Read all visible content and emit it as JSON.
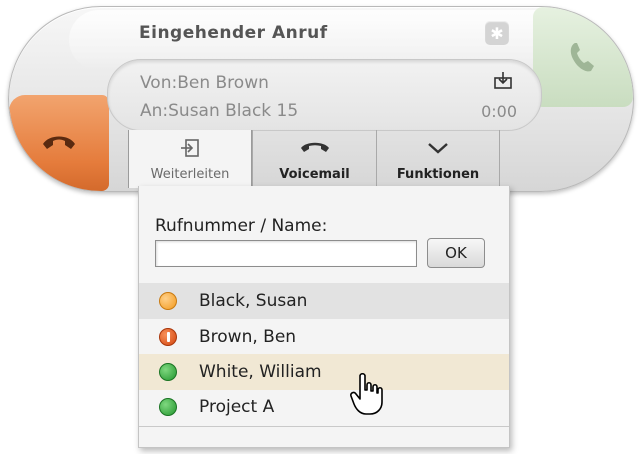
{
  "call": {
    "title": "Eingehender Anruf",
    "from": "Von:Ben Brown",
    "to": "An:Susan Black 15",
    "timer": "0:00"
  },
  "tabs": [
    {
      "label": "Weiterleiten",
      "icon": "forward-icon",
      "active": true
    },
    {
      "label": "Voicemail",
      "icon": "voicemail-icon",
      "active": false
    },
    {
      "label": "Funktionen",
      "icon": "chevron-down-icon",
      "active": false
    }
  ],
  "forward": {
    "label": "Rufnummer / Name:",
    "input_value": "",
    "ok_label": "OK"
  },
  "contacts": [
    {
      "name": "Black, Susan",
      "status": "away",
      "color": "#f5a83a"
    },
    {
      "name": "Brown, Ben",
      "status": "busy",
      "color": "#e0591c"
    },
    {
      "name": "White, William",
      "status": "available",
      "color": "#2fa53a"
    },
    {
      "name": "Project A",
      "status": "available",
      "color": "#2fa53a"
    }
  ],
  "colors": {
    "reject": "#e57c3c",
    "accept": "#c9ddc0",
    "selected_row": "#e2e2e2",
    "hover_row": "#f1e8d4"
  },
  "icons": {
    "reject": "hang-up-icon",
    "accept": "phone-icon",
    "star": "star-icon",
    "download": "download-icon",
    "cursor": "hand-cursor-icon"
  }
}
